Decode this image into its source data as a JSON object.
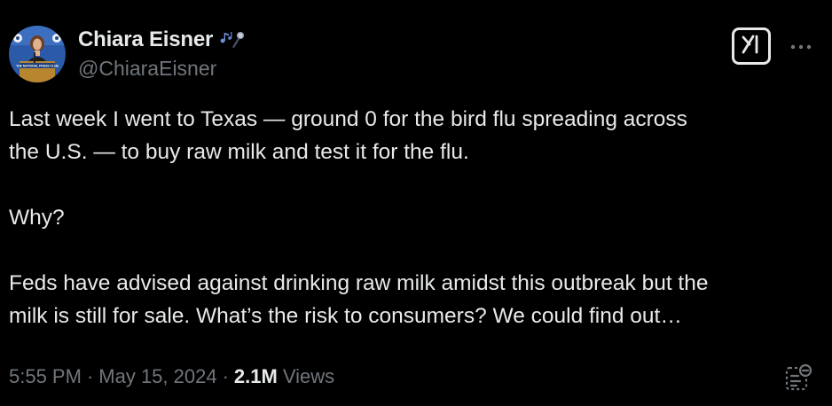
{
  "author": {
    "display_name": "Chiara Eisner",
    "handle": "@ChiaraEisner",
    "avatar_banner_text": "THE NATIONAL PRESS CLUB",
    "name_emoji": "notes-and-microphone-icon"
  },
  "tweet": {
    "paragraphs": [
      {
        "lines": [
          "Last week I went to Texas — ground 0 for the bird flu spreading across",
          "the U.S. — to buy raw milk and test it for the flu."
        ]
      },
      {
        "lines": [
          "Why?"
        ]
      },
      {
        "lines": [
          "Feds have advised against drinking raw milk amidst this outbreak but the",
          "milk is still for sale. What’s the risk to consumers? We could find out…"
        ]
      }
    ]
  },
  "meta": {
    "time": "5:55 PM",
    "separator": "·",
    "date": "May 15, 2024",
    "views_count": "2.1M",
    "views_label": "Views"
  },
  "icons": {
    "grok": "grok-icon",
    "more": "more-options-icon",
    "analytics": "view-analytics-icon"
  },
  "colors": {
    "background": "#000000",
    "primary_text": "#e7e9ea",
    "secondary_text": "#71767b"
  }
}
